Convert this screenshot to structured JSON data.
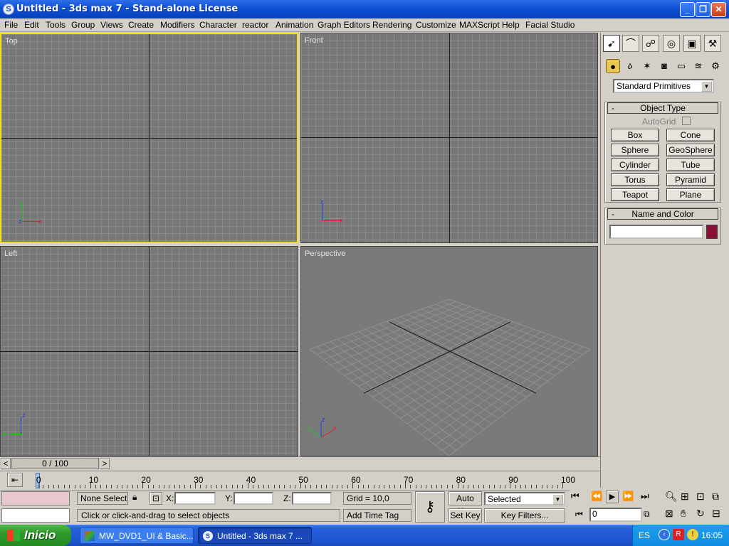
{
  "window": {
    "app_icon": "3dsmax-logo-icon",
    "title": "Untitled - 3ds max 7  - Stand-alone License",
    "minimize_icon": "_",
    "maximize_icon": "❐",
    "close_icon": "✕"
  },
  "menu": {
    "items": [
      "File",
      "Edit",
      "Tools",
      "Group",
      "Views",
      "Create",
      "Modifiers",
      "Character",
      "reactor",
      "Animation",
      "Graph Editors",
      "Rendering",
      "Customize",
      "MAXScript",
      "Help",
      "Facial Studio"
    ]
  },
  "viewports": {
    "top": {
      "label": "Top",
      "active": true
    },
    "front": {
      "label": "Front"
    },
    "left": {
      "label": "Left"
    },
    "perspective": {
      "label": "Perspective"
    }
  },
  "axes": {
    "x": "x",
    "y": "y",
    "z": "z"
  },
  "command_panel": {
    "tabs": [
      "create-icon",
      "modify-icon",
      "hierarchy-icon",
      "motion-icon",
      "display-icon",
      "utilities-icon"
    ],
    "subcategories": [
      "geometry-icon",
      "shapes-icon",
      "lights-icon",
      "cameras-icon",
      "helpers-icon",
      "spacewarps-icon",
      "systems-icon"
    ],
    "category": "Standard Primitives",
    "object_type": {
      "title": "Object Type",
      "autogrid": "AutoGrid",
      "buttons": [
        "Box",
        "Cone",
        "Sphere",
        "GeoSphere",
        "Cylinder",
        "Tube",
        "Torus",
        "Pyramid",
        "Teapot",
        "Plane"
      ]
    },
    "name_color": {
      "title": "Name and Color",
      "name_value": "",
      "color": "#8b1035"
    }
  },
  "timeline": {
    "frame_display": "0 / 100",
    "prev": "<",
    "next": ">",
    "ruler_labels": [
      "0",
      "10",
      "20",
      "30",
      "40",
      "50",
      "60",
      "70",
      "80",
      "90",
      "100"
    ]
  },
  "status": {
    "selection": "None Selecte",
    "x_label": "X:",
    "y_label": "Y:",
    "z_label": "Z:",
    "grid": "Grid = 10,0",
    "prompt": "Click or click-and-drag to select objects",
    "add_time_tag": "Add Time Tag",
    "auto_key": "Auto Key",
    "set_key": "Set Key",
    "selected": "Selected",
    "key_filters": "Key Filters...",
    "current_frame": "0"
  },
  "taskbar": {
    "start": "Inicio",
    "items": [
      "MW_DVD1_UI & Basic...",
      "Untitled - 3ds max 7  ..."
    ],
    "lang": "ES",
    "clock": "16:05"
  }
}
